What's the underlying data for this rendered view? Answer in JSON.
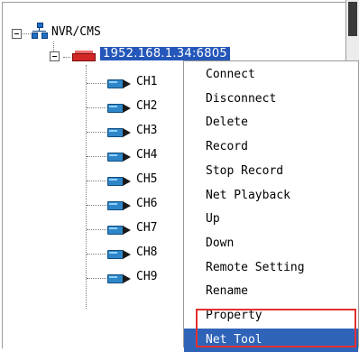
{
  "tree": {
    "root_label": "NVR/CMS",
    "device_label": "1952.168.1.34:6805",
    "channels": [
      "CH1",
      "CH2",
      "CH3",
      "CH4",
      "CH5",
      "CH6",
      "CH7",
      "CH8",
      "CH9"
    ]
  },
  "menu": {
    "items": [
      "Connect",
      "Disconnect",
      "Delete",
      "Record",
      "Stop Record",
      "Net Playback",
      "Up",
      "Down",
      "Remote Setting",
      "Rename",
      "Property",
      "Net Tool"
    ],
    "selected": "Net Tool"
  },
  "colors": {
    "selection": "#2f63b8",
    "highlight_box": "#e53030"
  }
}
